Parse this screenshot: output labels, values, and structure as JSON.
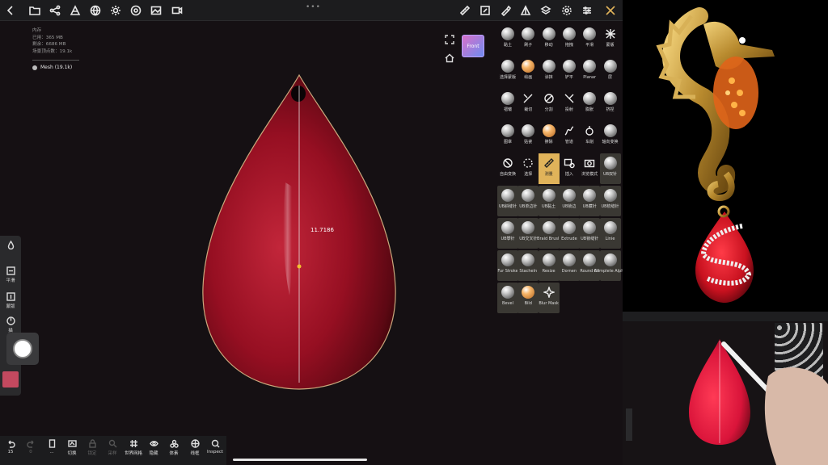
{
  "stats": {
    "line1": "内存",
    "line2": "已用：365 MB",
    "line3": "剩余：6686 MB",
    "line4": "场景顶点数：19.1k"
  },
  "scene": {
    "mesh_label": "Mesh (19.1k)",
    "measurement": "11.7186",
    "view_cube_label": "Front"
  },
  "topbar_icons": [
    "back-icon",
    "folder-icon",
    "share-icon",
    "layers-icon",
    "globe-icon",
    "sun-icon",
    "material-icon",
    "image-icon",
    "video-icon",
    "ruler-icon",
    "scale-icon",
    "brush-icon",
    "mask-icon",
    "stack-icon",
    "gear-icon",
    "sliders-icon",
    "tools-icon"
  ],
  "brushes": [
    {
      "label": "黏土"
    },
    {
      "label": "刷子"
    },
    {
      "label": "移动"
    },
    {
      "label": "拖拽"
    },
    {
      "label": "平滑"
    },
    {
      "label": "蒙版"
    },
    {
      "label": "选择蒙版"
    },
    {
      "label": "绘画"
    },
    {
      "label": "涂抹"
    },
    {
      "label": "铲平"
    },
    {
      "label": "Planar"
    },
    {
      "label": "层"
    },
    {
      "label": "褶皱"
    },
    {
      "label": "裁切"
    },
    {
      "label": "分割"
    },
    {
      "label": "投射"
    },
    {
      "label": "膨胀"
    },
    {
      "label": "挤捏"
    },
    {
      "label": "图章"
    },
    {
      "label": "贴瓷"
    },
    {
      "label": "擦除"
    },
    {
      "label": "管道"
    },
    {
      "label": "车削"
    },
    {
      "label": "轴向变换"
    },
    {
      "label": "自由变换"
    },
    {
      "label": "选择"
    },
    {
      "label": "测量"
    },
    {
      "label": "插入"
    },
    {
      "label": "浏览模式"
    },
    {
      "label": "UB双针"
    },
    {
      "label": "UB斜缝针"
    },
    {
      "label": "UB单边针"
    },
    {
      "label": "UB黏土"
    },
    {
      "label": "UB锁边"
    },
    {
      "label": "UB藏针"
    },
    {
      "label": "UB梳缝针"
    },
    {
      "label": "UB攀针"
    },
    {
      "label": "UB交叉针"
    },
    {
      "label": "Braid Brush"
    },
    {
      "label": "Extrude"
    },
    {
      "label": "UB锁缝针"
    },
    {
      "label": "Linie"
    },
    {
      "label": "Fur Stroke"
    },
    {
      "label": "Stacheln"
    },
    {
      "label": "Resize"
    },
    {
      "label": "Dornen"
    },
    {
      "label": "Round All"
    },
    {
      "label": "Complete Alpha"
    },
    {
      "label": "Bevel"
    },
    {
      "label": "Bild"
    },
    {
      "label": "Blur Mask"
    }
  ],
  "left_toolbar": {
    "smooth": "平滑",
    "mask": "蒙版",
    "stroke": "描"
  },
  "bottom_toolbar": {
    "undo": "15",
    "redo": "0",
    "file": "...",
    "switch": "切换",
    "lock": "锁定",
    "sample": "采样",
    "grid": "世界网格",
    "hide": "隐藏",
    "volume": "体素",
    "wire": "线框",
    "inspect": "Inspect"
  },
  "colors": {
    "accent": "#e0b35a",
    "gem": "#9c1425",
    "brush_color": "#c3495f"
  }
}
